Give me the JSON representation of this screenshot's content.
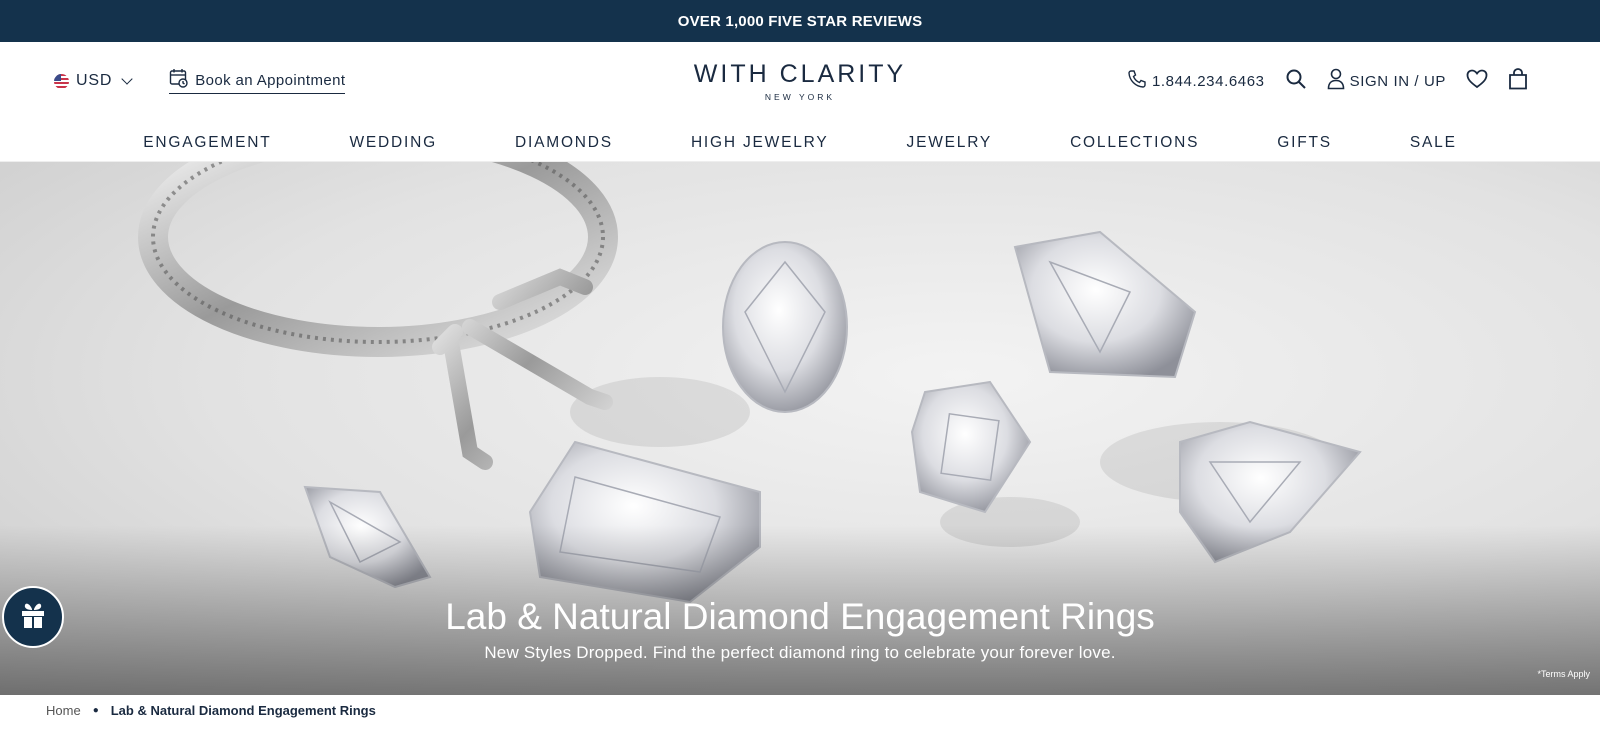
{
  "promo": {
    "text": "OVER 1,000 FIVE STAR REVIEWS"
  },
  "header": {
    "currency": "USD",
    "appointment": "Book an Appointment",
    "logo": {
      "main": "WITH CLARITY",
      "sub": "NEW YORK"
    },
    "phone": "1.844.234.6463",
    "signin": "SIGN IN / UP"
  },
  "nav": [
    "ENGAGEMENT",
    "WEDDING",
    "DIAMONDS",
    "HIGH JEWELRY",
    "JEWELRY",
    "COLLECTIONS",
    "GIFTS",
    "SALE"
  ],
  "hero": {
    "title": "Lab & Natural Diamond Engagement Rings",
    "subtitle": "New Styles Dropped. Find the perfect diamond ring to celebrate your forever love.",
    "terms": "*Terms Apply"
  },
  "breadcrumb": {
    "home": "Home",
    "current": "Lab & Natural Diamond Engagement Rings"
  },
  "colors": {
    "navy": "#14324c",
    "text": "#1a2a40"
  },
  "icons": [
    "us-flag-icon",
    "chevron-down-icon",
    "calendar-icon",
    "phone-icon",
    "search-icon",
    "user-icon",
    "heart-icon",
    "bag-icon",
    "gift-icon"
  ]
}
